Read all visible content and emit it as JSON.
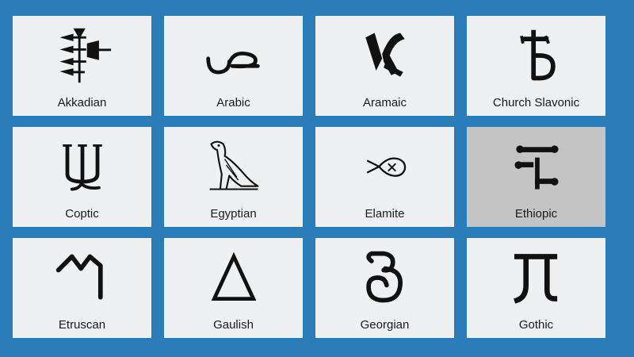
{
  "cards": [
    {
      "label": "Akkadian",
      "icon": "cuneiform-sign-icon"
    },
    {
      "label": "Arabic",
      "icon": "arabic-sad-letter-icon"
    },
    {
      "label": "Aramaic",
      "icon": "aramaic-letter-icon"
    },
    {
      "label": "Church Slavonic",
      "icon": "yat-letter-icon"
    },
    {
      "label": "Coptic",
      "icon": "coptic-shai-letter-icon"
    },
    {
      "label": "Egyptian",
      "icon": "vulture-hieroglyph-icon"
    },
    {
      "label": "Elamite",
      "icon": "elamite-sign-icon"
    },
    {
      "label": "Ethiopic",
      "icon": "ethiopic-letter-icon",
      "selected": true
    },
    {
      "label": "Etruscan",
      "icon": "etruscan-letter-icon"
    },
    {
      "label": "Gaulish",
      "icon": "delta-letter-icon"
    },
    {
      "label": "Georgian",
      "icon": "georgian-letter-icon"
    },
    {
      "label": "Gothic",
      "icon": "gothic-letter-icon"
    }
  ],
  "colors": {
    "background": "#2a7db8",
    "card": "#eef0f1",
    "selected": "#c4c4c4"
  }
}
